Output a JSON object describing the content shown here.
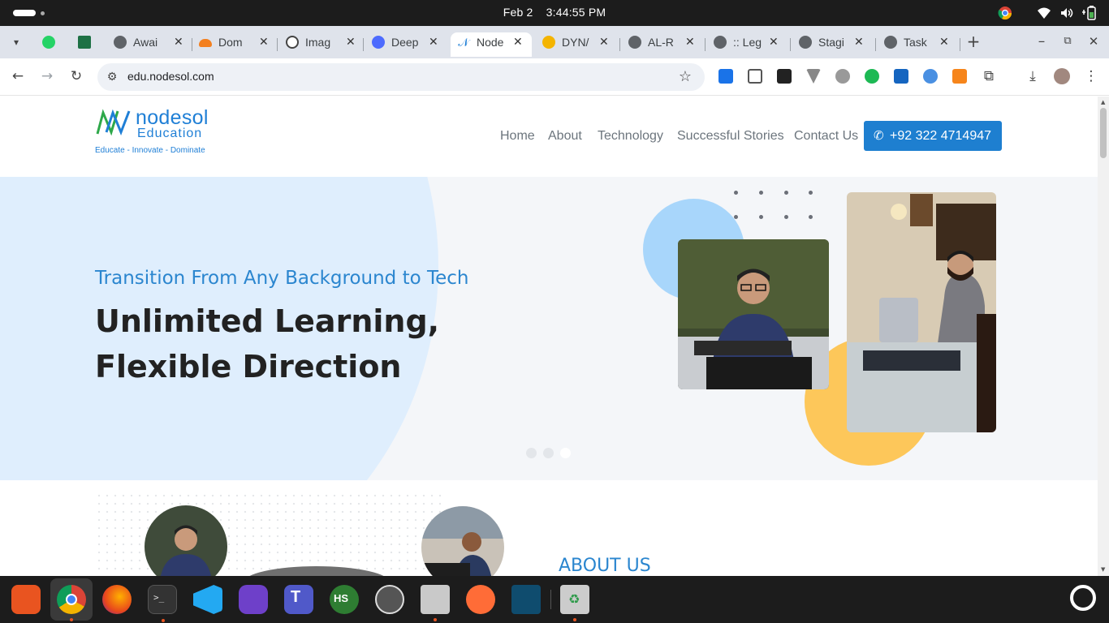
{
  "topbar": {
    "date": "Feb 2",
    "time": "3:44:55 PM"
  },
  "tabs": [
    {
      "label": "",
      "color": "#34a853"
    },
    {
      "label": "",
      "color": "#1e7145"
    },
    {
      "label": "Awai",
      "color": "#5f6368"
    },
    {
      "label": "Dom",
      "color": "#f38020"
    },
    {
      "label": "Imag",
      "color": "#444"
    },
    {
      "label": "Deep",
      "color": "#4d6bfe"
    },
    {
      "label": "Node",
      "color": "#1f7fd6"
    },
    {
      "label": "DYN/",
      "color": "#f4b400"
    },
    {
      "label": "AL-R",
      "color": "#5f6368"
    },
    {
      "label": ":: Leg",
      "color": "#5f6368"
    },
    {
      "label": "Stagi",
      "color": "#5f6368"
    },
    {
      "label": "Task",
      "color": "#5f6368"
    }
  ],
  "toolbar": {
    "url": "edu.nodesol.com"
  },
  "site": {
    "logo": {
      "brand": "nodesol",
      "sub": "Education",
      "tagline": "Educate - Innovate - Dominate"
    },
    "nav": [
      "Home",
      "About",
      "Technology",
      "Successful Stories",
      "Contact Us"
    ],
    "phone": "+92 322 4714947",
    "hero": {
      "kicker": "Transition From Any Background to Tech",
      "headline_1": "Unlimited Learning,",
      "headline_2": "Flexible Direction"
    },
    "about": {
      "heading": "ABOUT US"
    }
  },
  "dock": [
    "app-center-icon",
    "chrome-icon",
    "firefox-icon",
    "terminal-icon",
    "vscode-icon",
    "github-desktop-icon",
    "teams-for-linux-icon",
    "hs-icon",
    "ubuntu-installer-icon",
    "files-icon",
    "postman-icon",
    "mysql-workbench-icon",
    "trash-icon",
    "show-apps-icon"
  ]
}
